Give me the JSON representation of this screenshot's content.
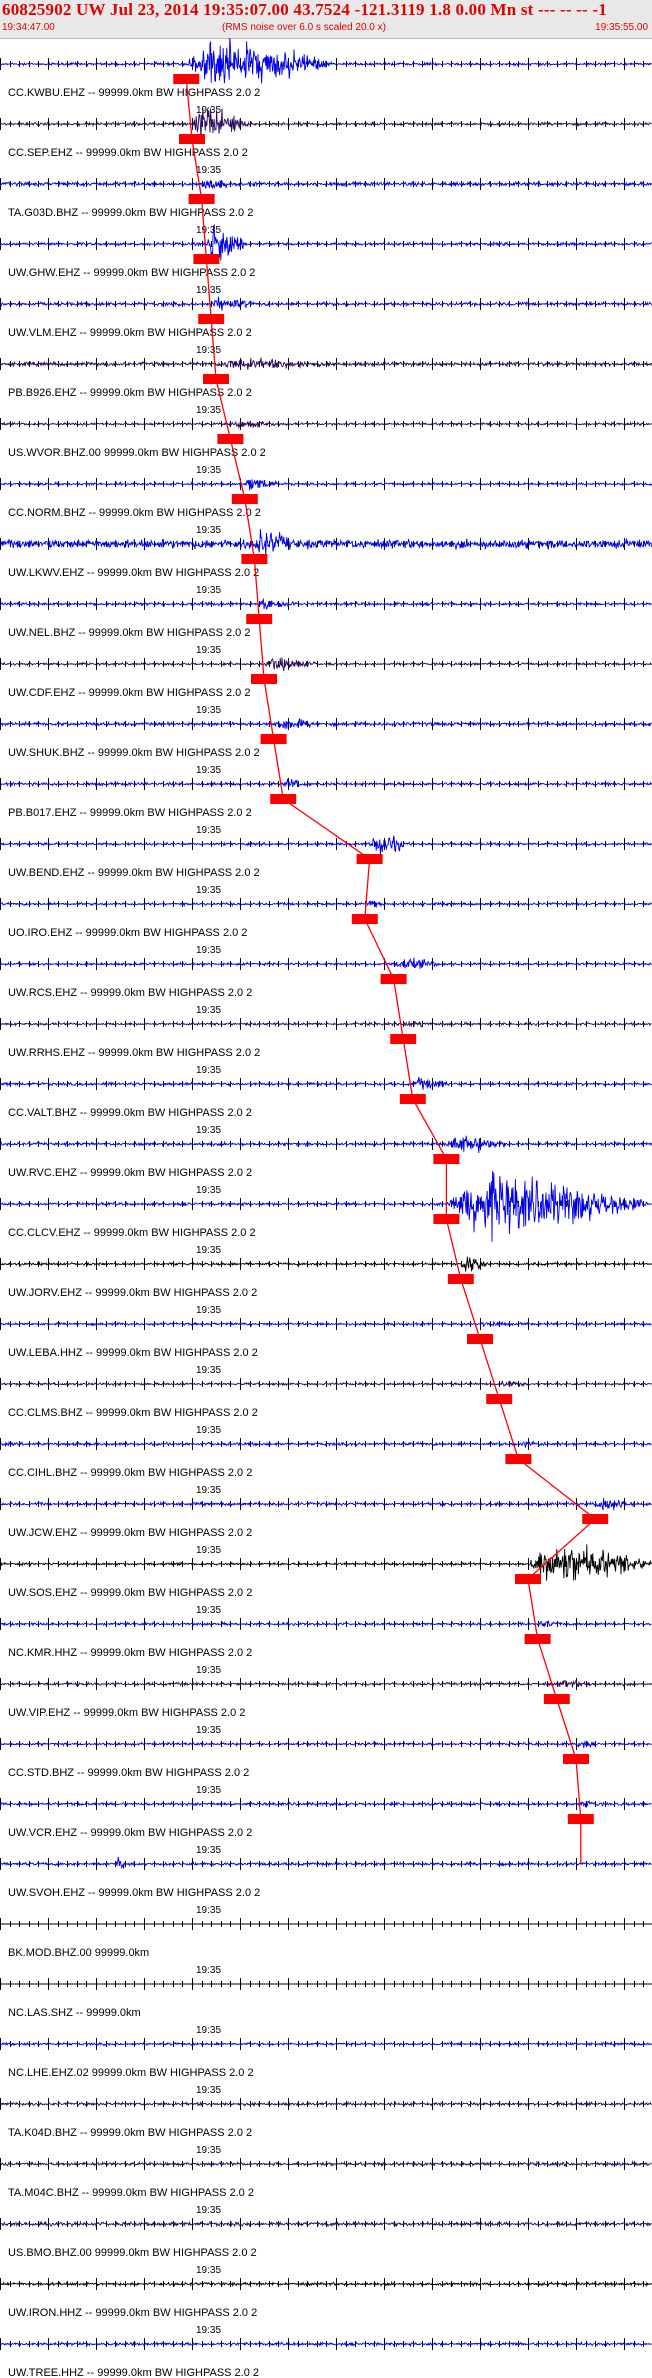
{
  "header": {
    "title": "60825902 UW Jul 23, 2014 19:35:07.00   43.7524 -121.3119  1.8 0.00 Mn st --- -- --  -1",
    "start_time": "19:34:47.00",
    "subtitle": "(RMS noise over 6.0 s scaled 20.0 x)",
    "end_time": "19:35:55.00"
  },
  "chart_data": {
    "type": "line",
    "title": "60825902 UW Jul 23, 2014 19:35:07.00   43.7524 -121.3119  1.8 0.00 Mn st --- -- --  -1",
    "subtitle": "(RMS noise over 6.0 s scaled 20.0 x)",
    "x_range": [
      "19:34:47.00",
      "19:35:55.00"
    ],
    "x_tick_label": "19:35",
    "grid": false,
    "colors": {
      "trace_blue": "#0000ee",
      "trace_purple": "#2a0a5e",
      "trace_black": "#000000",
      "pick": "#ff0000",
      "title": "#e00000"
    },
    "traces": [
      {
        "label": "CC.KWBU.EHZ -- 99999.0km BW  HIGHPASS  2.0  2",
        "tick": "19:35",
        "color": "blue",
        "noise": 0.3,
        "pick": true,
        "event": {
          "start": 19.4,
          "end": 34.6,
          "amp": 7
        }
      },
      {
        "label": "CC.SEP.EHZ -- 99999.0km BW  HIGHPASS  2.0  2",
        "tick": "19:35",
        "color": "purple",
        "noise": 0.35,
        "pick": true,
        "event": {
          "start": 20.0,
          "end": 26.0,
          "amp": 5
        }
      },
      {
        "label": "TA.G03D.BHZ -- 99999.0km BW  HIGHPASS  2.0  2",
        "tick": "19:35",
        "color": "blue",
        "noise": 0.45,
        "pick": true,
        "event": {
          "start": 21.0,
          "end": 24.0,
          "amp": 1.5
        }
      },
      {
        "label": "UW.GHW.EHZ -- 99999.0km BW  HIGHPASS  2.0  2",
        "tick": "19:35",
        "color": "blue",
        "noise": 0.35,
        "pick": true,
        "event": {
          "start": 21.5,
          "end": 25.5,
          "amp": 7
        }
      },
      {
        "label": "UW.VLM.EHZ -- 99999.0km BW  HIGHPASS  2.0  2",
        "tick": "19:35",
        "color": "blue",
        "noise": 0.4,
        "pick": true,
        "event": {
          "start": 22.0,
          "end": 26.5,
          "amp": 1.5
        }
      },
      {
        "label": "PB.B926.EHZ -- 99999.0km BW  HIGHPASS  2.0  2",
        "tick": "19:35",
        "color": "purple",
        "noise": 0.45,
        "pick": true,
        "event": {
          "start": 22.5,
          "end": 34.0,
          "amp": 1.2
        }
      },
      {
        "label": "US.WVOR.BHZ.00 99999.0km BW  HIGHPASS  2.0  2",
        "tick": "19:35",
        "color": "purple",
        "noise": 0.3,
        "pick": true,
        "event": {
          "start": 24.0,
          "end": 29.0,
          "amp": 0.9
        }
      },
      {
        "label": "CC.NORM.BHZ -- 99999.0km BW  HIGHPASS  2.0  2",
        "tick": "19:35",
        "color": "blue",
        "noise": 0.3,
        "pick": true,
        "event": {
          "start": 25.5,
          "end": 29.0,
          "amp": 1.8
        }
      },
      {
        "label": "UW.LKWV.EHZ -- 99999.0km BW  HIGHPASS  2.0  2",
        "tick": "19:35",
        "color": "blue",
        "noise": 1.1,
        "pick": true,
        "event": {
          "start": 26.5,
          "end": 30.5,
          "amp": 3
        }
      },
      {
        "label": "UW.NEL.BHZ -- 99999.0km BW  HIGHPASS  2.0  2",
        "tick": "19:35",
        "color": "blue",
        "noise": 0.35,
        "pick": true,
        "event": {
          "start": 27.0,
          "end": 31.0,
          "amp": 1.5
        }
      },
      {
        "label": "UW.CDF.EHZ -- 99999.0km BW  HIGHPASS  2.0  2",
        "tick": "19:35",
        "color": "purple",
        "noise": 0.3,
        "pick": true,
        "event": {
          "start": 27.5,
          "end": 33.0,
          "amp": 1.6
        }
      },
      {
        "label": "UW.SHUK.BHZ -- 99999.0km BW  HIGHPASS  2.0  2",
        "tick": "19:35",
        "color": "blue",
        "noise": 0.4,
        "pick": true,
        "event": {
          "start": 28.5,
          "end": 33.0,
          "amp": 1.5
        }
      },
      {
        "label": "PB.B017.EHZ -- 99999.0km BW  HIGHPASS  2.0  2",
        "tick": "19:35",
        "color": "blue",
        "noise": 0.35,
        "pick": true,
        "event": {
          "start": 29.5,
          "end": 32.0,
          "amp": 1.2
        }
      },
      {
        "label": "UW.BEND.EHZ -- 99999.0km BW  HIGHPASS  2.0  2",
        "tick": "19:35",
        "color": "blue",
        "noise": 0.3,
        "pick": true,
        "event": {
          "start": 38.5,
          "end": 42.5,
          "amp": 3.5
        }
      },
      {
        "label": "UO.IRO.EHZ -- 99999.0km BW  HIGHPASS  2.0  2",
        "tick": "19:35",
        "color": "blue",
        "noise": 0.3,
        "pick": true,
        "event": {
          "start": 38.0,
          "end": 40.0,
          "amp": 1.2
        }
      },
      {
        "label": "UW.RCS.EHZ -- 99999.0km BW  HIGHPASS  2.0  2",
        "tick": "19:35",
        "color": "blue",
        "noise": 0.3,
        "pick": true,
        "event": {
          "start": 41.0,
          "end": 46.0,
          "amp": 1.5
        }
      },
      {
        "label": "UW.RRHS.EHZ -- 99999.0km BW  HIGHPASS  2.0  2",
        "tick": "19:35",
        "color": "purple",
        "noise": 0.3,
        "pick": true,
        "event": {
          "start": 42.0,
          "end": 45.0,
          "amp": 0.8
        }
      },
      {
        "label": "CC.VALT.BHZ -- 99999.0km BW  HIGHPASS  2.0  2",
        "tick": "19:35",
        "color": "blue",
        "noise": 0.35,
        "pick": true,
        "event": {
          "start": 43.0,
          "end": 47.0,
          "amp": 1.5
        }
      },
      {
        "label": "UW.RVC.EHZ -- 99999.0km BW  HIGHPASS  2.0  2",
        "tick": "19:35",
        "color": "blue",
        "noise": 0.35,
        "pick": true,
        "event": {
          "start": 46.5,
          "end": 53.0,
          "amp": 2.5
        }
      },
      {
        "label": "CC.CLCV.EHZ -- 99999.0km BW  HIGHPASS  2.0  2",
        "tick": "19:35",
        "color": "blue",
        "noise": 0.35,
        "pick": true,
        "event": {
          "start": 46.5,
          "end": 67.5,
          "amp": 9
        }
      },
      {
        "label": "UW.JORV.EHZ -- 99999.0km BW  HIGHPASS  2.0  2",
        "tick": "19:35",
        "color": "black",
        "noise": 0.3,
        "pick": true,
        "event": {
          "start": 48.0,
          "end": 51.0,
          "amp": 2.5
        }
      },
      {
        "label": "UW.LEBA.HHZ -- 99999.0km BW  HIGHPASS  2.0  2",
        "tick": "19:35",
        "color": "blue",
        "noise": 0.3,
        "pick": true,
        "event": {
          "start": 50.0,
          "end": 53.0,
          "amp": 0.7
        }
      },
      {
        "label": "CC.CLMS.BHZ -- 99999.0km BW  HIGHPASS  2.0  2",
        "tick": "19:35",
        "color": "purple",
        "noise": 0.3,
        "pick": true,
        "event": {
          "start": 52.0,
          "end": 55.0,
          "amp": 0.6
        }
      },
      {
        "label": "CC.CIHL.BHZ -- 99999.0km BW  HIGHPASS  2.0  2",
        "tick": "19:35",
        "color": "blue",
        "noise": 0.35,
        "pick": true,
        "event": {
          "start": 54.0,
          "end": 57.0,
          "amp": 0.6
        }
      },
      {
        "label": "UW.JCW.EHZ -- 99999.0km BW  HIGHPASS  2.0  2",
        "tick": "19:35",
        "color": "blue",
        "noise": 0.35,
        "pick": true,
        "event": {
          "start": 62.0,
          "end": 66.0,
          "amp": 1.8
        }
      },
      {
        "label": "UW.SOS.EHZ -- 99999.0km BW  HIGHPASS  2.0  2",
        "tick": "19:35",
        "color": "black",
        "noise": 0.3,
        "pick": true,
        "event": {
          "start": 55.0,
          "end": 68.0,
          "amp": 6
        }
      },
      {
        "label": "NC.KMR.HHZ -- 99999.0km BW  HIGHPASS  2.0  2",
        "tick": "19:35",
        "color": "blue",
        "noise": 0.3,
        "pick": true,
        "event": {
          "start": 56.0,
          "end": 59.0,
          "amp": 0.6
        }
      },
      {
        "label": "UW.VIP.EHZ -- 99999.0km BW  HIGHPASS  2.0  2",
        "tick": "19:35",
        "color": "purple",
        "noise": 0.35,
        "pick": true,
        "event": {
          "start": 58.0,
          "end": 62.0,
          "amp": 0.8
        }
      },
      {
        "label": "CC.STD.BHZ -- 99999.0km BW  HIGHPASS  2.0  2",
        "tick": "19:35",
        "color": "blue",
        "noise": 0.3,
        "pick": true,
        "event": {
          "start": 60.0,
          "end": 62.0,
          "amp": 1.0
        }
      },
      {
        "label": "UW.VCR.EHZ -- 99999.0km BW  HIGHPASS  2.0  2",
        "tick": "19:35",
        "color": "blue",
        "noise": 0.35,
        "pick": true,
        "event": {
          "start": 60.5,
          "end": 62.5,
          "amp": 0.7
        }
      },
      {
        "label": "UW.SVOH.EHZ -- 99999.0km BW  HIGHPASS  2.0  2",
        "tick": "19:35",
        "color": "blue",
        "noise": 0.35,
        "pick": false,
        "event": {
          "start": 12.0,
          "end": 13.0,
          "amp": 2.5
        }
      },
      {
        "label": "BK.MOD.BHZ.00 99999.0km",
        "tick": "19:35",
        "color": "flat",
        "noise": 0,
        "pick": false
      },
      {
        "label": "NC.LAS.SHZ -- 99999.0km",
        "tick": "19:35",
        "color": "flat",
        "noise": 0,
        "pick": false
      },
      {
        "label": "NC.LHE.EHZ.02 99999.0km BW  HIGHPASS  2.0  2",
        "tick": "19:35",
        "color": "blue",
        "noise": 0.3,
        "pick": false
      },
      {
        "label": "TA.K04D.BHZ -- 99999.0km BW  HIGHPASS  2.0  2",
        "tick": "19:35",
        "color": "purple",
        "noise": 0.35,
        "pick": false
      },
      {
        "label": "TA.M04C.BHZ -- 99999.0km BW  HIGHPASS  2.0  2",
        "tick": "19:35",
        "color": "purple",
        "noise": 0.4,
        "pick": false
      },
      {
        "label": "US.BMO.BHZ.00 99999.0km BW  HIGHPASS  2.0  2",
        "tick": "19:35",
        "color": "purple",
        "noise": 0.45,
        "pick": false
      },
      {
        "label": "UW.IRON.HHZ -- 99999.0km BW  HIGHPASS  2.0  2",
        "tick": "19:35",
        "color": "black",
        "noise": 0.35,
        "pick": false
      },
      {
        "label": "UW.TREE.HHZ -- 99999.0km BW  HIGHPASS  2.0  2",
        "tick": "19:35",
        "color": "blue",
        "noise": 0.35,
        "pick": false
      }
    ]
  }
}
